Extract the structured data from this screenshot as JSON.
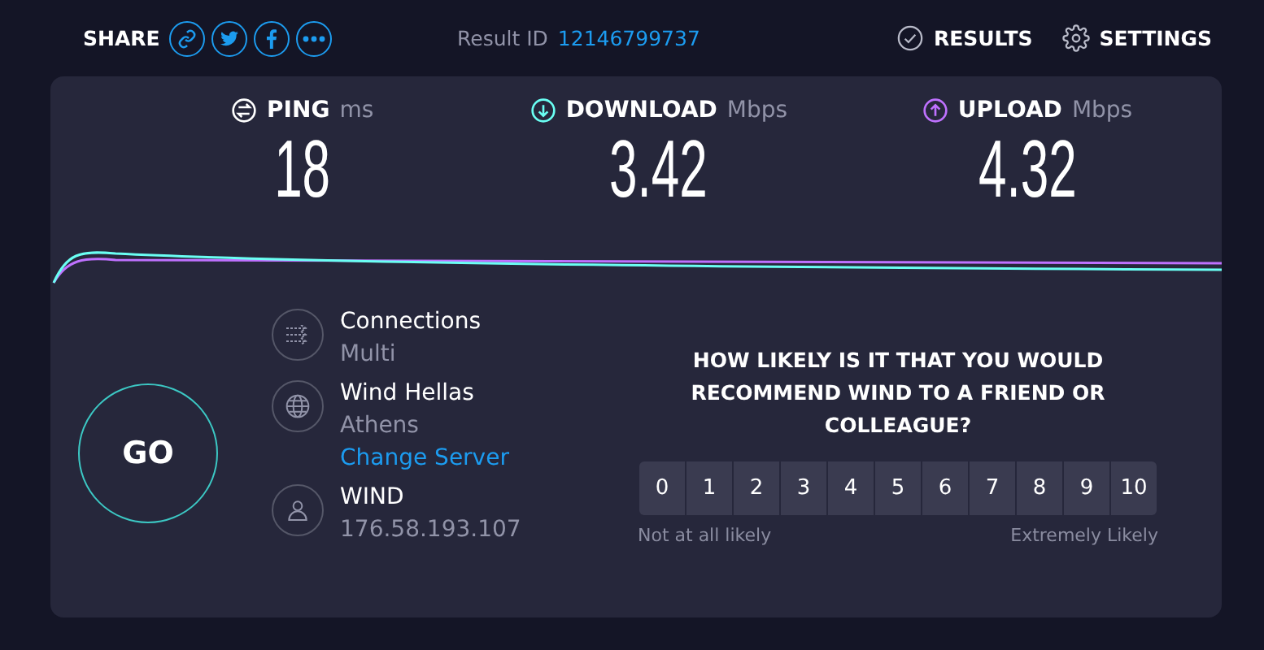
{
  "header": {
    "share_label": "SHARE",
    "share_buttons": [
      {
        "kind": "link"
      },
      {
        "kind": "twitter"
      },
      {
        "kind": "facebook"
      },
      {
        "kind": "more"
      }
    ],
    "result_label": "Result ID",
    "result_id": "12146799737",
    "nav": [
      {
        "kind": "results",
        "label": "RESULTS"
      },
      {
        "kind": "settings",
        "label": "SETTINGS"
      }
    ]
  },
  "metrics": [
    {
      "kind": "ping",
      "label": "PING",
      "unit": "ms",
      "value": "18",
      "color": "#ffffff"
    },
    {
      "kind": "download",
      "label": "DOWNLOAD",
      "unit": "Mbps",
      "value": "3.42",
      "color": "#6afff3"
    },
    {
      "kind": "upload",
      "label": "UPLOAD",
      "unit": "Mbps",
      "value": "4.32",
      "color": "#bf71ff"
    }
  ],
  "go_button": "GO",
  "info": [
    {
      "kind": "connections",
      "title": "Connections",
      "subtitle": "Multi"
    },
    {
      "kind": "server",
      "title": "Wind Hellas",
      "subtitle": "Athens",
      "link": "Change Server"
    },
    {
      "kind": "provider",
      "title": "WIND",
      "subtitle": "176.58.193.107"
    }
  ],
  "survey": {
    "question": "HOW LIKELY IS IT THAT YOU WOULD RECOMMEND WIND TO A FRIEND OR COLLEAGUE?",
    "scale": [
      "0",
      "1",
      "2",
      "3",
      "4",
      "5",
      "6",
      "7",
      "8",
      "9",
      "10"
    ],
    "low_label": "Not at all likely",
    "high_label": "Extremely Likely"
  }
}
